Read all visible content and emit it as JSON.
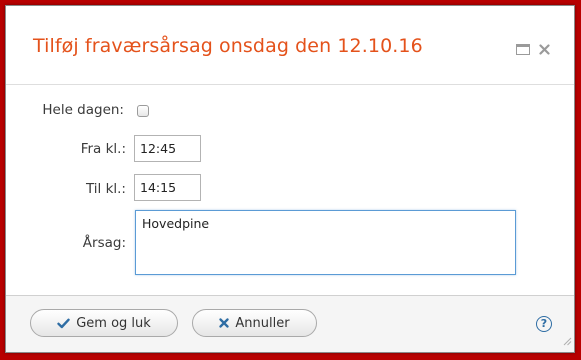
{
  "colors": {
    "backdrop": "#b80000",
    "title": "#e4521b",
    "accent": "#2e6da4"
  },
  "dialog": {
    "title": "Tilføj fraværsårsag onsdag den 12.10.16",
    "controls": [
      "maximize-icon",
      "close-icon"
    ]
  },
  "form": {
    "whole_day_label": "Hele dagen:",
    "whole_day_checked": false,
    "from_label": "Fra kl.:",
    "from_value": "12:45",
    "to_label": "Til kl.:",
    "to_value": "14:15",
    "reason_label": "Årsag:",
    "reason_value": "Hovedpine"
  },
  "footer": {
    "save_label": "Gem og luk",
    "save_icon": "checkmark-icon",
    "cancel_label": "Annuller",
    "cancel_icon": "x-icon",
    "help_label": "?"
  }
}
